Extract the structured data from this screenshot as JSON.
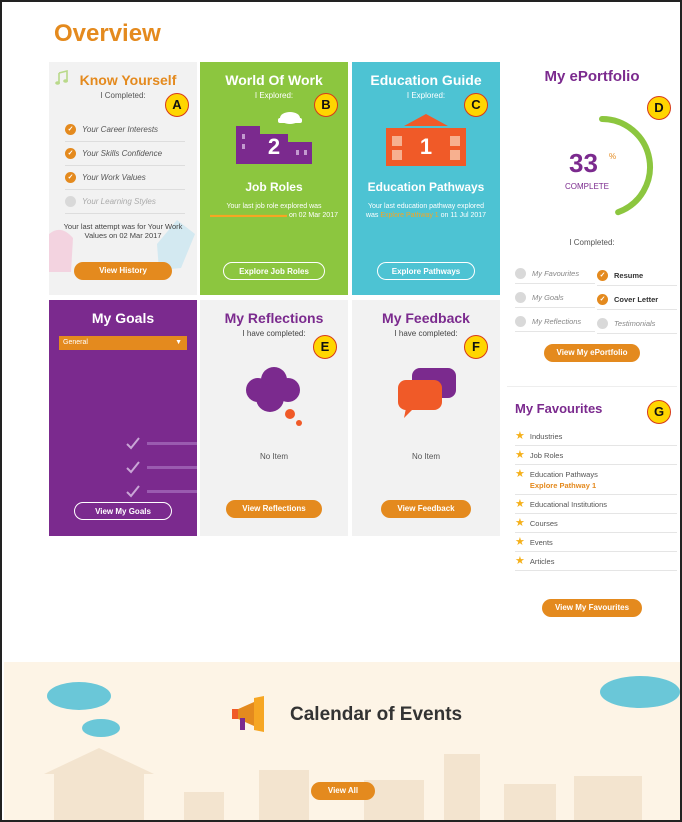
{
  "overview": {
    "title": "Overview"
  },
  "markers": [
    "A",
    "B",
    "C",
    "D",
    "E",
    "F",
    "G"
  ],
  "know_yourself": {
    "title": "Know Yourself",
    "subtitle": "I Completed:",
    "items": [
      {
        "label": "Your Career Interests",
        "done": true
      },
      {
        "label": "Your Skills Confidence",
        "done": true
      },
      {
        "label": "Your Work Values",
        "done": true
      },
      {
        "label": "Your Learning Styles",
        "done": false
      }
    ],
    "attempt": "Your last attempt was for Your Work Values on 02 Mar 2017",
    "button": "View History"
  },
  "world_of_work": {
    "title": "World Of Work",
    "subtitle": "I Explored:",
    "count": "2",
    "label": "Job Roles",
    "note_prefix": "Your last job role explored was",
    "note_date": "on 02 Mar 2017",
    "button": "Explore Job Roles"
  },
  "education_guide": {
    "title": "Education Guide",
    "subtitle": "I Explored:",
    "count": "1",
    "label": "Education Pathways",
    "note_prefix": "Your last education pathway explored was",
    "note_link": "Explore Pathway 1",
    "note_date": "on 11 Jul 2017",
    "button": "Explore Pathways"
  },
  "my_goals": {
    "title": "My Goals",
    "select_value": "General",
    "button": "View My Goals"
  },
  "my_reflections": {
    "title": "My Reflections",
    "subtitle": "I have completed:",
    "empty": "No Item",
    "button": "View Reflections"
  },
  "my_feedback": {
    "title": "My Feedback",
    "subtitle": "I have completed:",
    "empty": "No Item",
    "button": "View Feedback"
  },
  "eportfolio": {
    "title": "My ePortfolio",
    "progress": 33,
    "progress_text": "33",
    "percent_sign": "%",
    "complete_label": "COMPLETE",
    "completed_label": "I Completed:",
    "pending": [
      "My Favourites",
      "My Goals",
      "My Reflections",
      "Testimonials"
    ],
    "done": [
      "Resume",
      "Cover Letter"
    ],
    "button": "View My ePortfolio"
  },
  "favourites": {
    "title": "My Favourites",
    "items": [
      {
        "label": "Industries",
        "sub": ""
      },
      {
        "label": "Job Roles",
        "sub": ""
      },
      {
        "label": "Education Pathways",
        "sub": "Explore Pathway 1"
      },
      {
        "label": "Educational Institutions",
        "sub": ""
      },
      {
        "label": "Courses",
        "sub": ""
      },
      {
        "label": "Events",
        "sub": ""
      },
      {
        "label": "Articles",
        "sub": ""
      }
    ],
    "button": "View My Favourites"
  },
  "calendar": {
    "title": "Calendar of Events",
    "button": "View All"
  },
  "colors": {
    "orange": "#e48a1e",
    "purple": "#7b2a8e",
    "green": "#8cc63f",
    "teal": "#4dc3d3",
    "marker": "#ffd600"
  }
}
